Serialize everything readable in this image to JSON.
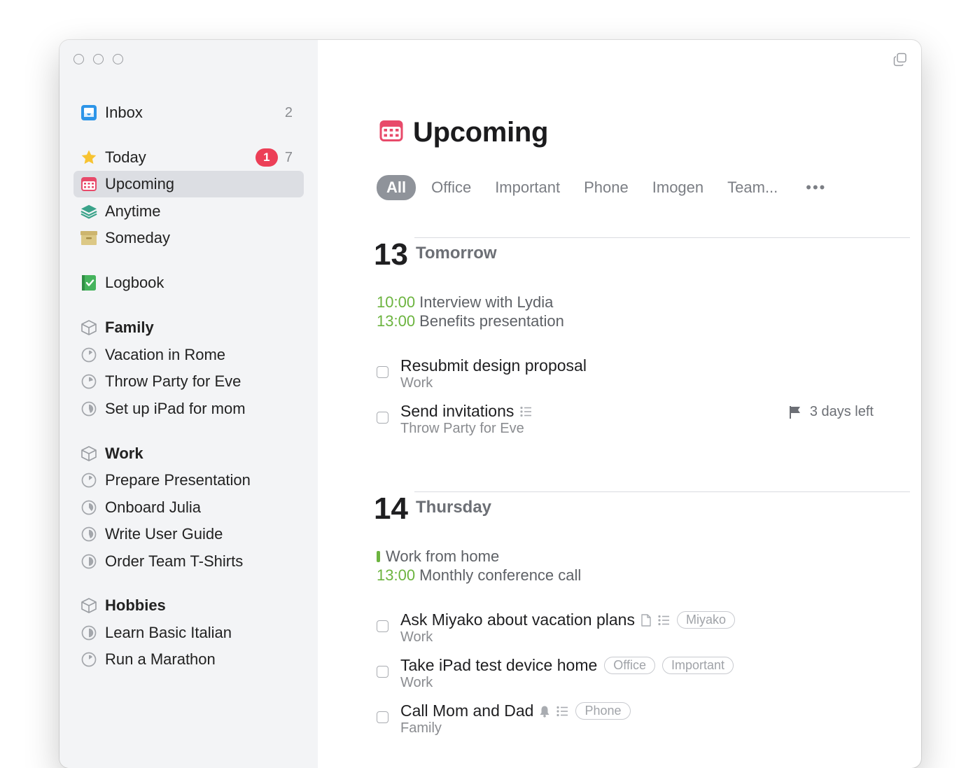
{
  "sidebar": {
    "inbox": {
      "label": "Inbox",
      "count": "2",
      "icon": "inbox-icon"
    },
    "today": {
      "label": "Today",
      "badge": "1",
      "count": "7",
      "icon": "star-icon"
    },
    "upcoming": {
      "label": "Upcoming",
      "icon": "calendar-icon"
    },
    "anytime": {
      "label": "Anytime",
      "icon": "layers-icon"
    },
    "someday": {
      "label": "Someday",
      "icon": "archive-box-icon"
    },
    "logbook": {
      "label": "Logbook",
      "icon": "logbook-icon"
    },
    "areas": [
      {
        "name": "Family",
        "projects": [
          "Vacation in Rome",
          "Throw Party for Eve",
          "Set up iPad for mom"
        ],
        "progress": [
          0.15,
          0.2,
          0.45
        ]
      },
      {
        "name": "Work",
        "projects": [
          "Prepare Presentation",
          "Onboard Julia",
          "Write User Guide",
          "Order Team T-Shirts"
        ],
        "progress": [
          0.15,
          0.4,
          0.45,
          0.5
        ]
      },
      {
        "name": "Hobbies",
        "projects": [
          "Learn Basic Italian",
          "Run a Marathon"
        ],
        "progress": [
          0.5,
          0.15
        ]
      }
    ]
  },
  "main": {
    "title": "Upcoming",
    "filters": [
      "All",
      "Office",
      "Important",
      "Phone",
      "Imogen",
      "Team..."
    ],
    "filter_active": "All",
    "filter_more": "•••",
    "days": [
      {
        "num": "13",
        "name": "Tomorrow",
        "events": [
          {
            "time": "10:00",
            "title": " Interview with Lydia"
          },
          {
            "time": "13:00",
            "title": " Benefits presentation"
          }
        ],
        "todos": [
          {
            "title": "Resubmit design proposal",
            "sub": "Work"
          },
          {
            "title": "Send invitations",
            "sub": "Throw Party for Eve",
            "deadline": "3 days left"
          }
        ]
      },
      {
        "num": "14",
        "name": "Thursday",
        "events": [
          {
            "time": "",
            "title": "Work from home"
          },
          {
            "time": "13:00",
            "title": " Monthly conference call"
          }
        ],
        "todos": [
          {
            "title": "Ask Miyako about vacation plans",
            "sub": "Work",
            "tags": [
              "Miyako"
            ]
          },
          {
            "title": "Take iPad test device home",
            "sub": "Work",
            "tags": [
              "Office",
              "Important"
            ]
          },
          {
            "title": "Call Mom and Dad",
            "sub": "Family",
            "tags": [
              "Phone"
            ]
          }
        ]
      }
    ]
  },
  "colors": {
    "accent_green": "#6cb43f",
    "badge_red": "#ec3f57",
    "calendar_pink": "#e84a6a",
    "inbox_blue": "#2d95e8",
    "star_yellow": "#f7c331",
    "logbook_green": "#45b35c"
  }
}
